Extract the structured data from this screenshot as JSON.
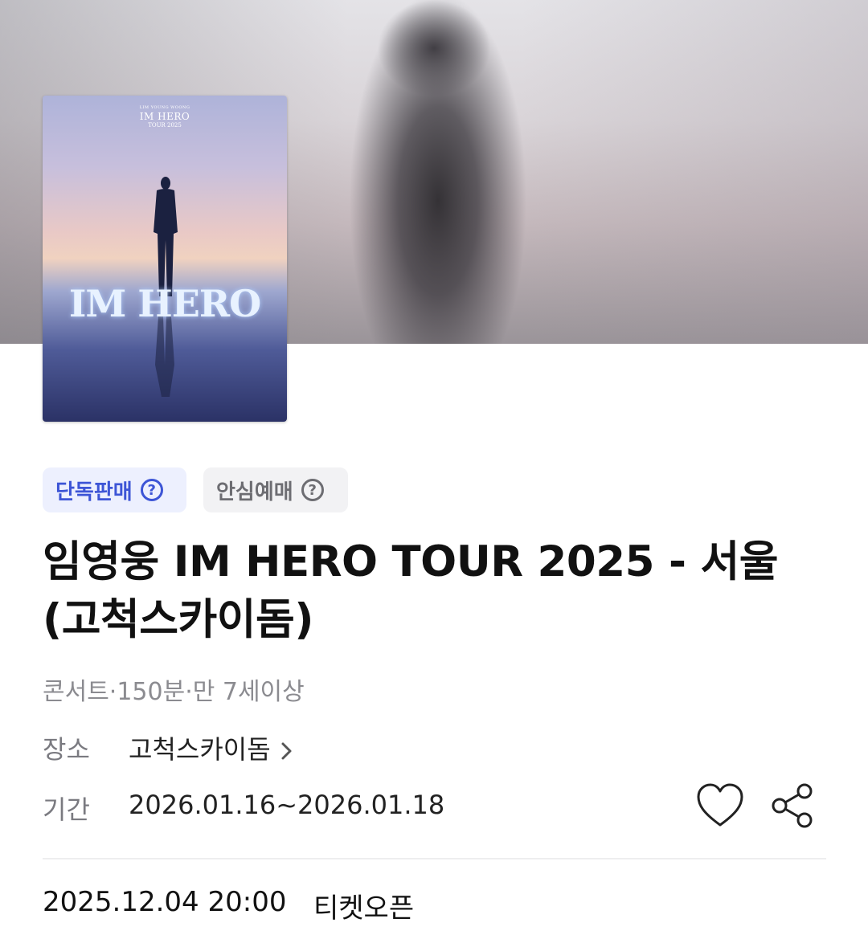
{
  "poster": {
    "small_text": "LIM YOUNG WOONG",
    "top_title": "IM HERO",
    "top_subtitle": "TOUR 2025",
    "big_title": "IM HERO"
  },
  "badges": {
    "exclusive": "단독판매",
    "safe": "안심예매"
  },
  "event": {
    "title": "임영웅 IM HERO TOUR 2025 - 서울(고척스카이돔)",
    "meta": "콘서트·150분·만 7세이상",
    "venue_label": "장소",
    "venue_value": "고척스카이돔",
    "period_label": "기간",
    "period_value": "2026.01.16~2026.01.18"
  },
  "ticket_open": {
    "datetime": "2025.12.04 20:00",
    "label": "티켓오픈"
  },
  "icons": {
    "help": "question-circle-icon",
    "venue_arrow": "chevron-right-icon",
    "like": "heart-icon",
    "share": "share-icon"
  },
  "colors": {
    "badge_blue_text": "#3d55d6",
    "badge_blue_bg": "#edf0fe",
    "badge_gray_text": "#6d6d72",
    "badge_gray_bg": "#f2f2f4"
  }
}
